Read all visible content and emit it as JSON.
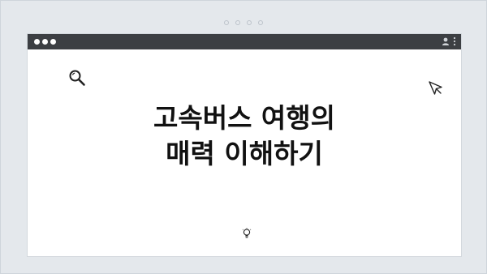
{
  "window": {
    "title_bar": {
      "controls": [
        "dot",
        "dot",
        "dot"
      ],
      "right_icons": [
        "user-icon",
        "kebab-menu-icon"
      ]
    }
  },
  "content": {
    "headline_line1": "고속버스 여행의",
    "headline_line2": "매력 이해하기",
    "icons": [
      "search-icon",
      "cursor-icon",
      "lightbulb-icon"
    ]
  },
  "colors": {
    "background": "#e4e8ec",
    "window": "#ffffff",
    "titlebar": "#3c3f43",
    "text": "#111111"
  }
}
